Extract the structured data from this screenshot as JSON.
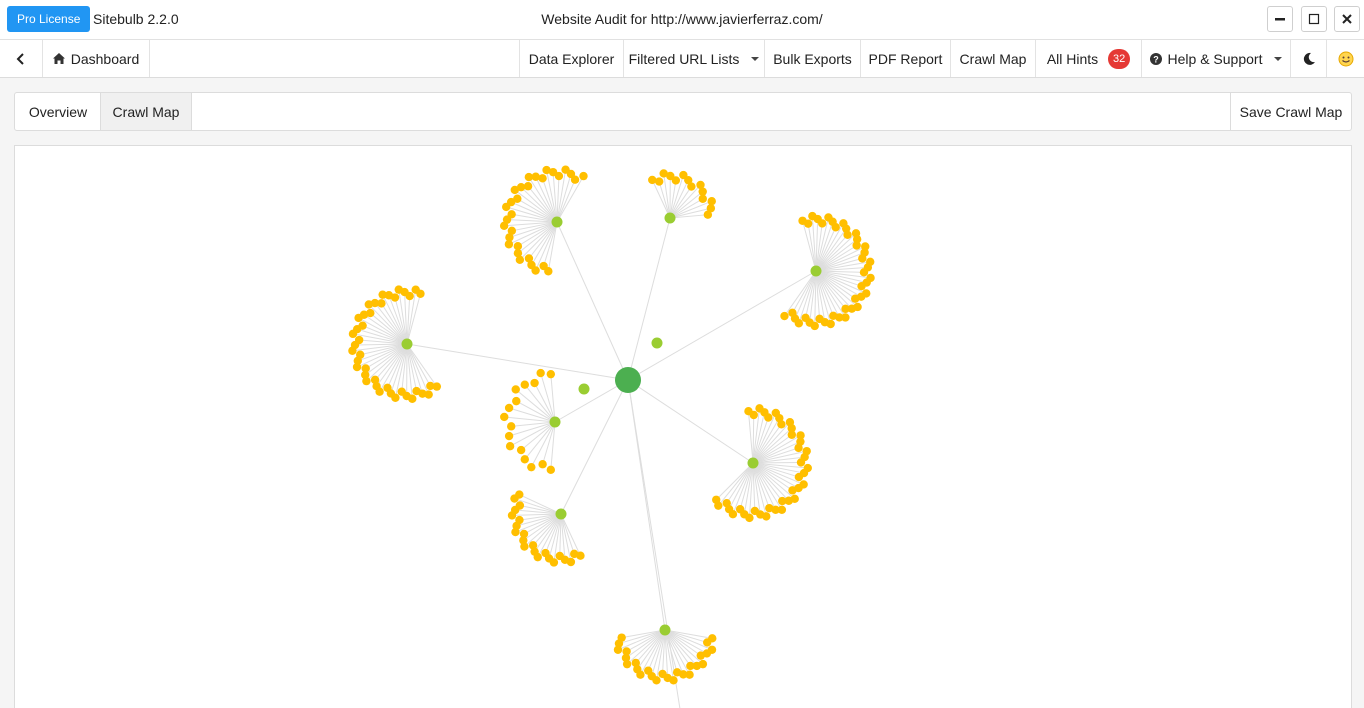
{
  "titlebar": {
    "license": "Pro License",
    "app_name": "Sitebulb 2.2.0",
    "window_title": "Website Audit for http://www.javierferraz.com/"
  },
  "navbar": {
    "back_icon": "chevron-left-icon",
    "dashboard_label": "Dashboard",
    "dashboard_icon": "home-icon",
    "items": [
      {
        "label": "Data Explorer"
      },
      {
        "label": "Filtered URL Lists"
      },
      {
        "label": "Bulk Exports"
      },
      {
        "label": "PDF Report"
      },
      {
        "label": "Crawl Map"
      },
      {
        "label": "All Hints"
      },
      {
        "label": "Help & Support"
      }
    ],
    "hints_count": "32",
    "theme_icon": "moon-icon",
    "feedback_icon": "smiley-icon"
  },
  "tabs": {
    "overview": "Overview",
    "crawl_map": "Crawl Map",
    "save_button": "Save Crawl Map"
  },
  "colors": {
    "accent": "#2196f3",
    "root_node": "#4caf50",
    "hub_node": "#9acd32",
    "leaf_node": "#ffbf00",
    "edge": "#dddddd",
    "badge": "#e53935"
  }
}
